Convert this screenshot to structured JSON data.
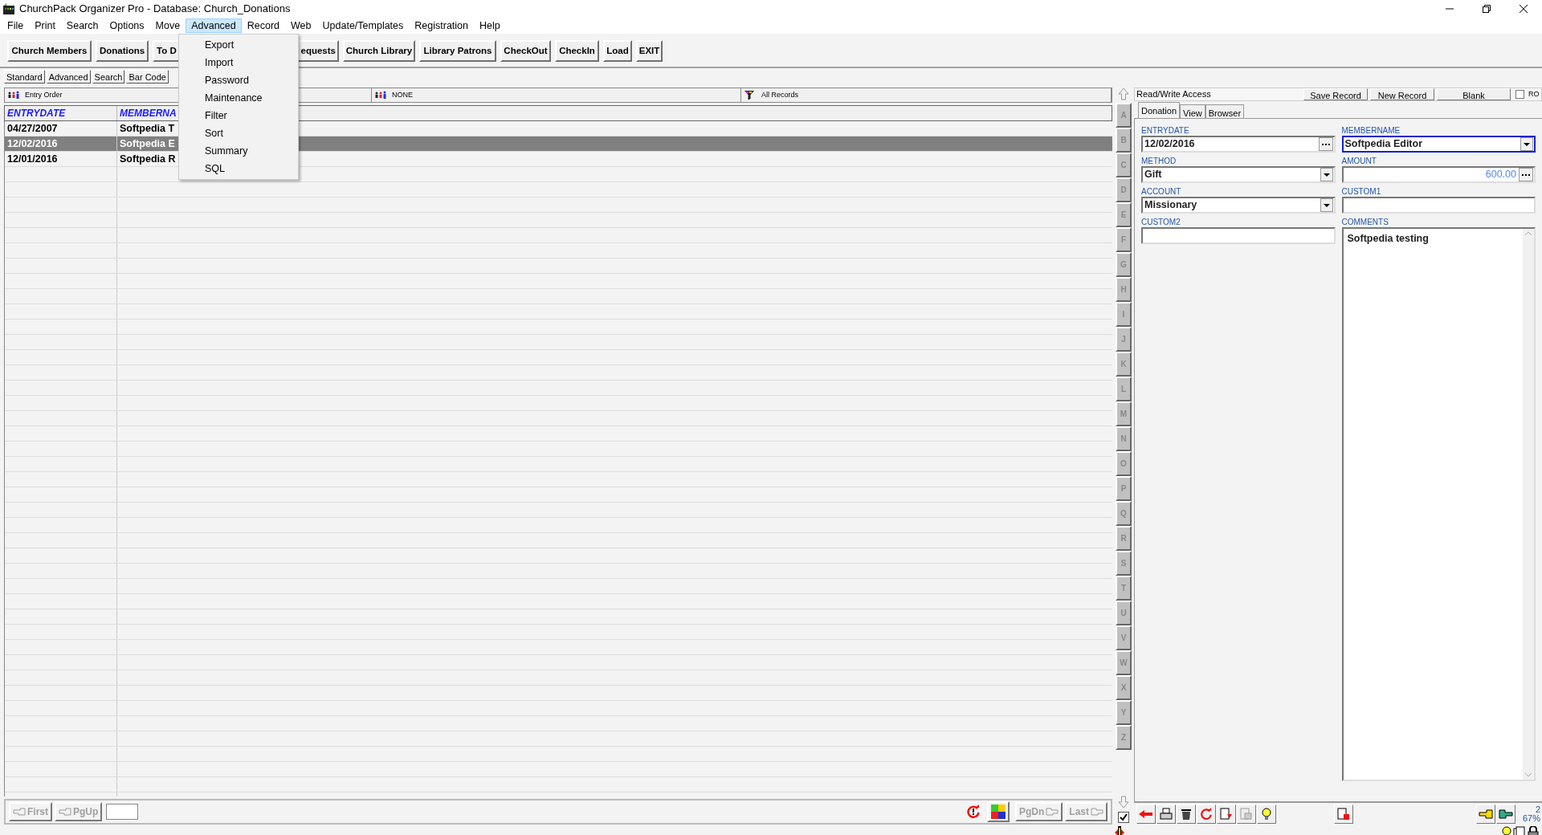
{
  "window": {
    "title": "ChurchPack Organizer Pro - Database: Church_Donations"
  },
  "menu_bar": [
    {
      "label": "File",
      "selected": false
    },
    {
      "label": "Print",
      "selected": false
    },
    {
      "label": "Search",
      "selected": false
    },
    {
      "label": "Options",
      "selected": false
    },
    {
      "label": "Move",
      "selected": false
    },
    {
      "label": "Advanced",
      "selected": true
    },
    {
      "label": "Record",
      "selected": false
    },
    {
      "label": "Web",
      "selected": false
    },
    {
      "label": "Update/Templates",
      "selected": false
    },
    {
      "label": "Registration",
      "selected": false
    },
    {
      "label": "Help",
      "selected": false
    }
  ],
  "open_menu": {
    "items": [
      "Export",
      "Import",
      "Password",
      "Maintenance",
      "Filter",
      "Sort",
      "Summary",
      "SQL"
    ]
  },
  "toolbar": [
    "Church Members",
    "Donations",
    "To D",
    "equests",
    "Church Library",
    "Library Patrons",
    "CheckOut",
    "CheckIn",
    "Load",
    "EXIT"
  ],
  "view_buttons": [
    "Standard",
    "Advanced",
    "Search",
    "Bar Code"
  ],
  "list_header": [
    "Entry Order",
    "NONE",
    "All Records"
  ],
  "table": {
    "columns": [
      "ENTRYDATE",
      "MEMBERNA"
    ],
    "rows": [
      {
        "cells": [
          "04/27/2007",
          "Softpedia T"
        ],
        "selected": false
      },
      {
        "cells": [
          "12/02/2016",
          "Softpedia E"
        ],
        "selected": true
      },
      {
        "cells": [
          "12/01/2016",
          "Softpedia R"
        ],
        "selected": false
      }
    ]
  },
  "alphabet": [
    "A",
    "B",
    "C",
    "D",
    "E",
    "F",
    "G",
    "H",
    "I",
    "J",
    "K",
    "L",
    "M",
    "N",
    "O",
    "P",
    "Q",
    "R",
    "S",
    "T",
    "U",
    "V",
    "W",
    "X",
    "Y",
    "Z"
  ],
  "nav_left": [
    {
      "label": "First",
      "disabled": true
    },
    {
      "label": "PgUp",
      "disabled": true
    }
  ],
  "nav_right": [
    {
      "label": "PgDn",
      "disabled": true
    },
    {
      "label": "Last",
      "disabled": true
    }
  ],
  "record_panel": {
    "access": "Read/Write Access",
    "buttons": [
      "Save Record",
      "New Record",
      "Blank"
    ],
    "ro": {
      "label": "RO",
      "checked": false
    },
    "tabs": [
      {
        "label": "Donation",
        "selected": true
      },
      {
        "label": "View",
        "selected": false
      },
      {
        "label": "Browser",
        "selected": false
      }
    ],
    "fields": [
      {
        "label": "ENTRYDATE",
        "value": "12/02/2016",
        "kind": "ellipsis",
        "focused": false
      },
      {
        "label": "MEMBERNAME",
        "value": "Softpedia Editor",
        "kind": "dropdown",
        "focused": true
      },
      {
        "label": "METHOD",
        "value": "Gift",
        "kind": "dropdown",
        "focused": false
      },
      {
        "label": "AMOUNT",
        "value": "600.00",
        "kind": "number",
        "focused": false
      },
      {
        "label": "ACCOUNT",
        "value": "Missionary",
        "kind": "dropdown",
        "focused": false
      },
      {
        "label": "CUSTOM1",
        "kind": "text",
        "focused": false
      },
      {
        "label": "CUSTOM2",
        "kind": "text",
        "focused": false
      },
      {
        "label": "COMMENTS",
        "value": "Softpedia testing",
        "kind": "memo",
        "focused": false
      }
    ],
    "sync_checked": true
  },
  "status": {
    "record_number": "2",
    "zoom": "67%"
  }
}
